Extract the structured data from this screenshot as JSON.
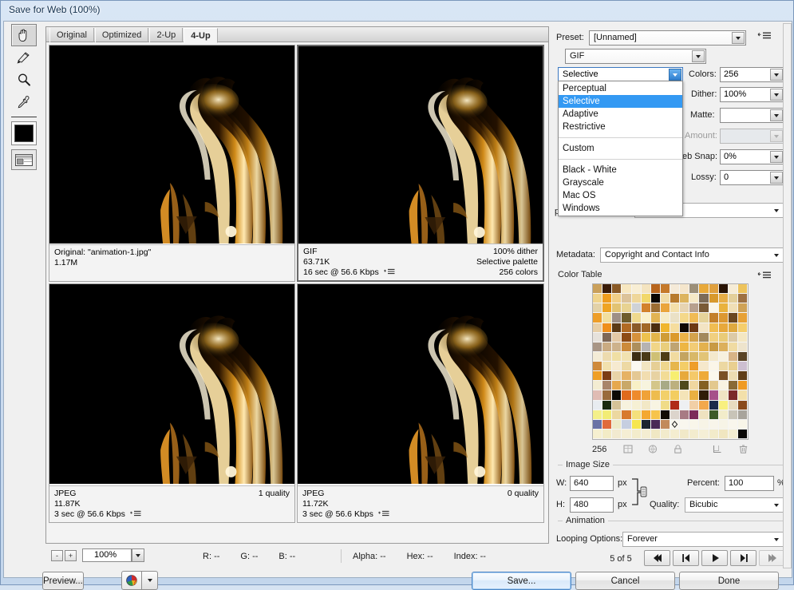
{
  "window": {
    "title": "Save for Web (100%)"
  },
  "toolbar": {
    "tools": [
      {
        "name": "hand-tool",
        "selected": true
      },
      {
        "name": "slice-select-tool",
        "selected": false
      },
      {
        "name": "zoom-tool",
        "selected": false
      },
      {
        "name": "eyedropper-tool",
        "selected": false
      }
    ],
    "foreground_color": "#000000",
    "slice_visibility_label": "Toggle Slices Visibility"
  },
  "tabs": [
    {
      "label": "Original",
      "active": false
    },
    {
      "label": "Optimized",
      "active": false
    },
    {
      "label": "2-Up",
      "active": false
    },
    {
      "label": "4-Up",
      "active": true
    }
  ],
  "previews": [
    {
      "id": "original",
      "selected": false,
      "line1_left": "Original: \"animation-1.jpg\"",
      "line1_right": "",
      "line2_left": "1.17M",
      "line2_right": "",
      "line3_left": "",
      "line3_right": "",
      "has_menu": false
    },
    {
      "id": "gif-optimized",
      "selected": true,
      "line1_left": "GIF",
      "line1_right": "100% dither",
      "line2_left": "63.71K",
      "line2_right": "Selective palette",
      "line3_left": "16 sec @ 56.6 Kbps",
      "line3_right": "256 colors",
      "has_menu": true
    },
    {
      "id": "jpeg-quality-1",
      "selected": false,
      "line1_left": "JPEG",
      "line1_right": "1 quality",
      "line2_left": "11.87K",
      "line2_right": "",
      "line3_left": "3 sec @ 56.6 Kbps",
      "line3_right": "",
      "has_menu": true
    },
    {
      "id": "jpeg-quality-0",
      "selected": false,
      "line1_left": "JPEG",
      "line1_right": "0 quality",
      "line2_left": "11.72K",
      "line2_right": "",
      "line3_left": "3 sec @ 56.6 Kbps",
      "line3_right": "",
      "has_menu": true
    }
  ],
  "statusbar": {
    "zoom_out": "-",
    "zoom_in": "+",
    "zoom_value": "100%",
    "r_label": "R:",
    "r_value": "--",
    "g_label": "G:",
    "g_value": "--",
    "b_label": "B:",
    "b_value": "--",
    "alpha_label": "Alpha:",
    "alpha_value": "--",
    "hex_label": "Hex:",
    "hex_value": "--",
    "index_label": "Index:",
    "index_value": "--"
  },
  "footer": {
    "preview_button": "Preview...",
    "browser_button_name": "preview-in-browser",
    "save_button": "Save...",
    "cancel_button": "Cancel",
    "done_button": "Done"
  },
  "settings": {
    "preset_label": "Preset:",
    "preset_value": "[Unnamed]",
    "format_value": "GIF",
    "reduction_value": "Selective",
    "reduction_options": [
      {
        "label": "Perceptual",
        "selected": false,
        "sep_after": false
      },
      {
        "label": "Selective",
        "selected": true,
        "sep_after": false
      },
      {
        "label": "Adaptive",
        "selected": false,
        "sep_after": false
      },
      {
        "label": "Restrictive",
        "selected": false,
        "sep_after": true
      },
      {
        "label": "Custom",
        "selected": false,
        "sep_after": true
      },
      {
        "label": "Black - White",
        "selected": false,
        "sep_after": false
      },
      {
        "label": "Grayscale",
        "selected": false,
        "sep_after": false
      },
      {
        "label": "Mac OS",
        "selected": false,
        "sep_after": false
      },
      {
        "label": "Windows",
        "selected": false,
        "sep_after": false
      }
    ],
    "colors_label": "Colors:",
    "colors_value": "256",
    "dither_label": "Dither:",
    "dither_value": "100%",
    "matte_label": "Matte:",
    "matte_value": "",
    "amount_label": "Amount:",
    "amount_value": "",
    "websnap_label": "eb Snap:",
    "websnap_value": "0%",
    "lossy_label": "Lossy:",
    "lossy_value": "0",
    "transparency_label": "p",
    "transparency_value": "",
    "metadata_label": "Metadata:",
    "metadata_value": "Copyright and Contact Info"
  },
  "color_table": {
    "title": "Color Table",
    "count": "256",
    "buttons": [
      "web-shift-icon",
      "snap-to-web-icon",
      "lock-color-icon",
      "new-color-icon",
      "delete-color-icon"
    ],
    "swatches": [
      "#caa05a",
      "#3a1c08",
      "#8a5a26",
      "#f7e7c0",
      "#f8eed4",
      "#f4e4c0",
      "#b8651d",
      "#c5792a",
      "#f5ead8",
      "#f5e6cc",
      "#9c8f78",
      "#e8a93a",
      "#e0a03e",
      "#2a1405",
      "#f6ecd6",
      "#edc35c",
      "#f0d48c",
      "#ee9d1e",
      "#f2cf86",
      "#dcc39a",
      "#efd79a",
      "#f2d86a",
      "#0a0603",
      "#f0dca8",
      "#b77a2d",
      "#ddb45e",
      "#f6e9c6",
      "#7c6b58",
      "#d8992c",
      "#e8ae46",
      "#e3cf9a",
      "#9d7042",
      "#e3d2a8",
      "#efa422",
      "#e2c372",
      "#e8d392",
      "#cfd2d6",
      "#d3822c",
      "#9b6d33",
      "#eaa53c",
      "#f4dfaa",
      "#e7d4b2",
      "#b7a08e",
      "#7a5a36",
      "#faf5e8",
      "#e9b23e",
      "#f0dfb6",
      "#cfa256",
      "#ee9e28",
      "#f2df9e",
      "#9e8f86",
      "#6e5c2c",
      "#efd98e",
      "#faf1cd",
      "#e2b453",
      "#f6ecc8",
      "#eae1c6",
      "#f4d88a",
      "#f0bb55",
      "#e6d39a",
      "#c37f2a",
      "#dc9832",
      "#6b4720",
      "#e7a135",
      "#e8cfa6",
      "#ef8f1c",
      "#5c3a16",
      "#b16a23",
      "#8a5a28",
      "#a26828",
      "#4b2d10",
      "#f0b62e",
      "#f5dd9e",
      "#100804",
      "#6e3a14",
      "#f3e4c4",
      "#f0bd52",
      "#e7a83c",
      "#dfa93f",
      "#f5ce6c",
      "#e6e2dc",
      "#7e6756",
      "#e4c9a6",
      "#8d4b16",
      "#d6923c",
      "#eec24e",
      "#e2b44a",
      "#cf9c36",
      "#db9a2c",
      "#ecb348",
      "#d4a34c",
      "#a3895c",
      "#f0d080",
      "#e9cb78",
      "#dccaa6",
      "#f4e7c2",
      "#a89585",
      "#caab82",
      "#cdb28c",
      "#cc8a3a",
      "#ad8f5c",
      "#b6b3b2",
      "#f1d688",
      "#e9ce7c",
      "#bfa472",
      "#edb644",
      "#f2cc76",
      "#e3b14e",
      "#c89a44",
      "#dcb05c",
      "#f0dba2",
      "#eee4cc",
      "#f4ecd6",
      "#eddbae",
      "#f0dfa4",
      "#f1e2b0",
      "#3c2e14",
      "#4a3a18",
      "#cfc074",
      "#4e3c16",
      "#f1dba0",
      "#c4a460",
      "#d8b868",
      "#e2c476",
      "#f4e9cc",
      "#f7f1de",
      "#d8b486",
      "#5a4426",
      "#cf8a3c",
      "#f2e1ae",
      "#f6ead0",
      "#edd9a4",
      "#fcfaf2",
      "#f2e6c2",
      "#e6cf96",
      "#eed68e",
      "#e6b64c",
      "#f3cd68",
      "#ee9e2a",
      "#f5e8cc",
      "#fbf6e8",
      "#ecd8a2",
      "#e9cf90",
      "#cdbfd0",
      "#ef9e24",
      "#7c3c14",
      "#e8d4a8",
      "#e6b264",
      "#e4c894",
      "#f1ddb0",
      "#e7d2a2",
      "#f2dc96",
      "#f7ee70",
      "#e7a93c",
      "#f4c96a",
      "#eeaa3a",
      "#fbf8ee",
      "#7a5024",
      "#ecdcb2",
      "#603e18",
      "#f3ecd2",
      "#a8856a",
      "#e6a84e",
      "#c9a868",
      "#f8f0c6",
      "#f7f4de",
      "#d4c68a",
      "#a8aa86",
      "#bcb07e",
      "#4e4a1c",
      "#f0d7a0",
      "#846022",
      "#e3c88e",
      "#f9f3e2",
      "#8a6a36",
      "#ef9a22",
      "#e0bcb4",
      "#9a6a3c",
      "#0e0a06",
      "#e06a1c",
      "#ee8a2c",
      "#f0a238",
      "#eebc4e",
      "#f2d06a",
      "#f3cd60",
      "#f4e4b8",
      "#e9b042",
      "#2e1c08",
      "#a6508a",
      "#f0e4c4",
      "#7c2a2a",
      "#f3e0aa",
      "#e8ecf0",
      "#1a2a10",
      "#d4c298",
      "#f7f2de",
      "#f6f0d4",
      "#f2e8c6",
      "#f8f4e2",
      "#f0dc88",
      "#b02a18",
      "#eef0f2",
      "#f1cfa6",
      "#f3a84c",
      "#1c2a4a",
      "#f8f080",
      "#e8dcc0",
      "#8a4a1c",
      "#f4f08a",
      "#f2ec74",
      "#ecd8a0",
      "#d87a2e",
      "#f4e07c",
      "#f4a830",
      "#f7c44c",
      "#120c06",
      "#dcd4cc",
      "#a87a84",
      "#7c2a5a",
      "#eee2c0",
      "#3c5a28",
      "#f2ecca",
      "#c8c4b8",
      "#a8a49c",
      "#6a72a6",
      "#e06a3c",
      "#edeac8",
      "#c6cee0",
      "#f6e650",
      "#1c2430",
      "#4a2a56",
      "#c28a5c",
      "#f8f6ee",
      "#f9f7ee",
      "#f9f6ea",
      "#f7f4e6",
      "#f8f5ea",
      "#f7f4e6",
      "#f9f6ec",
      "#f8f5e8",
      "#f6f0d0",
      "#f3ecc6",
      "#f2ead0",
      "#f5eed4",
      "#f3eccc",
      "#f4edd2",
      "#f0e8c4",
      "#f2ebcc",
      "#f4edd0",
      "#f1e9c8",
      "#f3ecce",
      "#f5efd6",
      "#f2ebca",
      "#f0e6c0",
      "#f4eed2",
      "#0a0806"
    ],
    "selected_index": 232
  },
  "image_size": {
    "title": "Image Size",
    "w_label": "W:",
    "w_value": "640",
    "w_unit": "px",
    "h_label": "H:",
    "h_value": "480",
    "h_unit": "px",
    "percent_label": "Percent:",
    "percent_value": "100",
    "percent_unit": "%",
    "quality_label": "Quality:",
    "quality_value": "Bicubic",
    "constrain_icon": "link-icon"
  },
  "animation": {
    "title": "Animation",
    "looping_label": "Looping Options:",
    "looping_value": "Forever",
    "frame_counter": "5 of 5",
    "controls": [
      {
        "name": "first-frame-button",
        "glyph": "◀◀",
        "disabled": false
      },
      {
        "name": "previous-frame-button",
        "glyph": "◀|",
        "disabled": false
      },
      {
        "name": "play-button",
        "glyph": "▶",
        "disabled": false
      },
      {
        "name": "next-frame-button",
        "glyph": "|▶",
        "disabled": false
      },
      {
        "name": "last-frame-button",
        "glyph": "▶▶",
        "disabled": true
      }
    ]
  }
}
